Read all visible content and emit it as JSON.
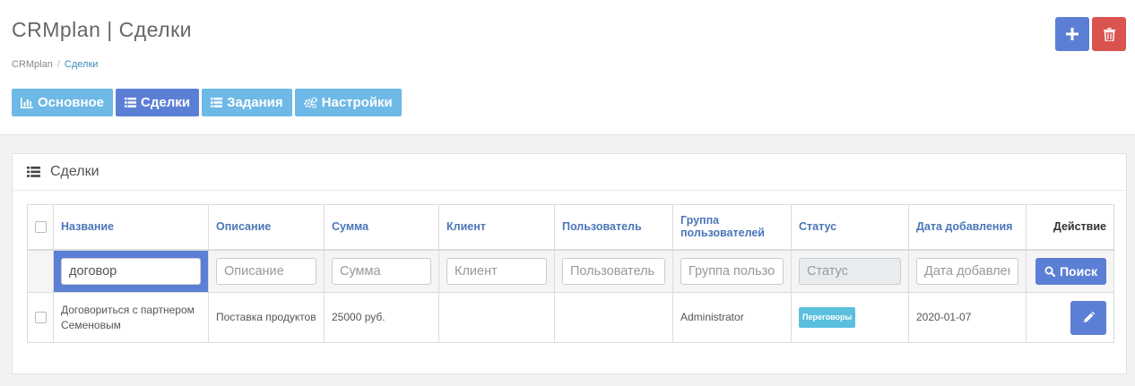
{
  "header": {
    "title": "CRMplan | Сделки",
    "breadcrumb": {
      "home": "CRMplan",
      "separator": "/",
      "current": "Сделки"
    },
    "add_icon": "plus-icon",
    "delete_icon": "trash-icon"
  },
  "tabs": [
    {
      "label": "Основное",
      "icon": "bar-chart-icon",
      "active": false
    },
    {
      "label": "Сделки",
      "icon": "list-icon",
      "active": true
    },
    {
      "label": "Задания",
      "icon": "list-icon",
      "active": false
    },
    {
      "label": "Настройки",
      "icon": "cogs-icon",
      "active": false
    }
  ],
  "panel": {
    "title": "Сделки",
    "icon": "list-icon"
  },
  "table": {
    "columns": [
      "Название",
      "Описание",
      "Сумма",
      "Клиент",
      "Пользователь",
      "Группа пользователей",
      "Статус",
      "Дата добавления",
      "Действие"
    ],
    "filters": {
      "name_value": "договор",
      "description_placeholder": "Описание",
      "sum_placeholder": "Сумма",
      "client_placeholder": "Клиент",
      "user_placeholder": "Пользователь",
      "group_placeholder": "Группа пользователей",
      "status_placeholder": "Статус",
      "date_placeholder": "Дата добавления",
      "search_label": "Поиск"
    },
    "rows": [
      {
        "name": "Договориться с партнером Семеновым",
        "description": "Поставка продуктов",
        "sum": "25000 руб.",
        "client": "",
        "user": "",
        "group": "Administrator",
        "status": "Переговоры",
        "date": "2020-01-07"
      }
    ]
  },
  "colors": {
    "primary": "#5c7fd6",
    "tab": "#6eb9e6",
    "danger": "#d9534f",
    "status_badge": "#5bc0de",
    "link": "#3c8dbc"
  }
}
